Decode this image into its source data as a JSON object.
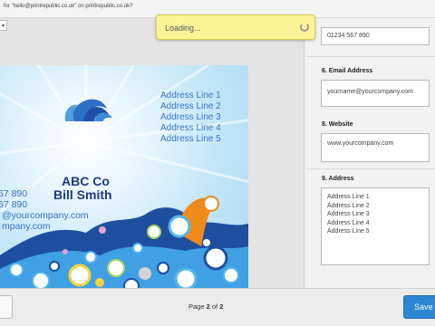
{
  "browser": {
    "notice": "for \"hello@printrepublic.co.uk\" on printrepublic.co.uk?"
  },
  "loading": {
    "text": "Loading..."
  },
  "card": {
    "company": "ABC Co",
    "person": "Bill Smith",
    "address_lines": [
      "Address Line 1",
      "Address Line 2",
      "Address Line 3",
      "Address Line 4",
      "Address Line 5"
    ],
    "partial_contacts": [
      "67 890",
      "67 890",
      "@yourcompany.com",
      "mpany.com"
    ]
  },
  "form": {
    "phone_value": "01234 567 890",
    "email": {
      "label": "6. Email Address",
      "value": "yourname@yourcompany.com"
    },
    "website": {
      "label": "8. Website",
      "value": "www.yourcompany.com"
    },
    "address": {
      "label": "9. Address",
      "lines": [
        "Address Line 1",
        "Address Line 2",
        "Address Line 3",
        "Address Line 4",
        "Address Line 5"
      ]
    }
  },
  "footer": {
    "page_prefix": "Page",
    "page_current": "2",
    "page_of": "of",
    "page_total": "2",
    "save_label": "Save"
  },
  "colors": {
    "loading_bg": "#fbf497",
    "save_button": "#2c86d6",
    "card_text": "#3b73c8",
    "card_title": "#1e3a86"
  }
}
